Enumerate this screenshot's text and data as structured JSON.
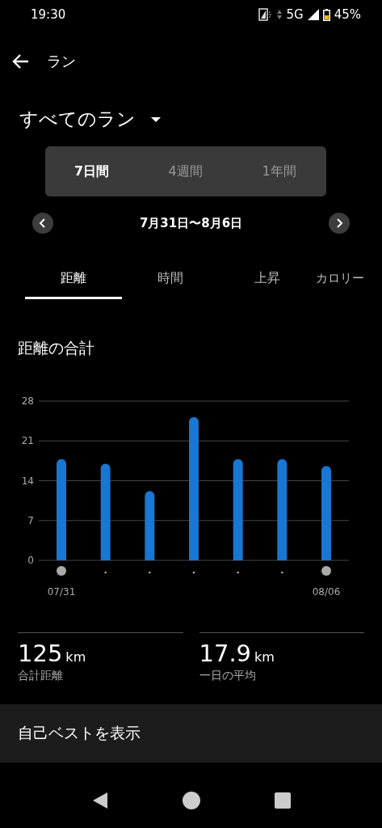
{
  "status_bar": {
    "time": "19:30",
    "network": "5G",
    "battery": "45%"
  },
  "header": {
    "title": "ラン"
  },
  "filter": {
    "label": "すべてのラン"
  },
  "periods": [
    {
      "label": "7日間",
      "selected": true
    },
    {
      "label": "4週間",
      "selected": false
    },
    {
      "label": "1年間",
      "selected": false
    }
  ],
  "date_range": "7月31日〜8月6日",
  "tabs": [
    {
      "label": "距離",
      "selected": true
    },
    {
      "label": "時間",
      "selected": false
    },
    {
      "label": "上昇",
      "selected": false
    },
    {
      "label": "カロリー",
      "selected": false
    }
  ],
  "section_title": "距離の合計",
  "chart": {
    "x_axis_labels": [
      "07/31",
      "08/06"
    ],
    "chart_data": {
      "type": "bar",
      "yticks": [
        0,
        7,
        14,
        21,
        28
      ],
      "ylim": [
        0,
        28
      ],
      "grid": true,
      "series": [
        {
          "color": "#1976d2",
          "values": [
            17.8,
            17.0,
            12.2,
            25.2,
            17.8,
            17.8,
            16.6
          ]
        }
      ]
    }
  },
  "stats": [
    {
      "value": "125",
      "unit": "km",
      "label": "合計距離"
    },
    {
      "value": "17.9",
      "unit": "km",
      "label": "一日の平均"
    }
  ],
  "best_button": "自己ベストを表示"
}
